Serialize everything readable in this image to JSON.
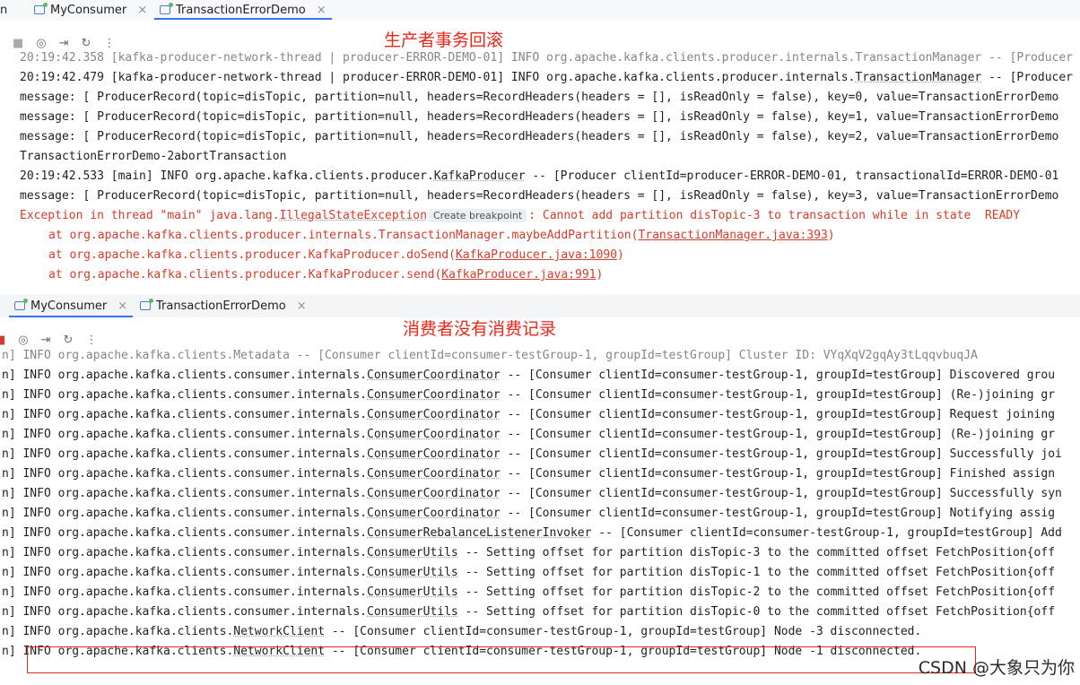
{
  "top_panel": {
    "tab_left_fragment": "n",
    "tabs": [
      {
        "label": "MyConsumer",
        "active": false
      },
      {
        "label": "TransactionErrorDemo",
        "active": true
      }
    ],
    "annotation": "生产者事务回滚",
    "create_breakpoint": "Create breakpoint",
    "lines": [
      {
        "kind": "partial",
        "text": "20:19:42.358 [kafka-producer-network-thread | producer-ERROR-DEMO-01] INFO org.apache.kafka.clients.producer.internals.TransactionManager -- [Producer"
      },
      {
        "kind": "log",
        "pre": "20:19:42.479 [kafka-producer-network-thread | producer-ERROR-DEMO-01] INFO org.apache.kafka.clients.producer.internals.",
        "cls": "TransactionManager",
        "post": " -- [Producer"
      },
      {
        "kind": "log",
        "pre": "message: [ ProducerRecord(topic=disTopic, partition=null, headers=RecordHeaders(headers = [], isReadOnly = false), key=0, value=TransactionErrorDemo"
      },
      {
        "kind": "log",
        "pre": "message: [ ProducerRecord(topic=disTopic, partition=null, headers=RecordHeaders(headers = [], isReadOnly = false), key=1, value=TransactionErrorDemo"
      },
      {
        "kind": "log",
        "pre": "message: [ ProducerRecord(topic=disTopic, partition=null, headers=RecordHeaders(headers = [], isReadOnly = false), key=2, value=TransactionErrorDemo"
      },
      {
        "kind": "log",
        "pre": "TransactionErrorDemo-2abortTransaction"
      },
      {
        "kind": "log",
        "pre": "20:19:42.533 [main] INFO org.apache.kafka.clients.producer.",
        "cls": "KafkaProducer",
        "post": " -- [Producer clientId=producer-ERROR-DEMO-01, transactionalId=ERROR-DEMO-01"
      },
      {
        "kind": "log",
        "pre": "message: [ ProducerRecord(topic=disTopic, partition=null, headers=RecordHeaders(headers = [], isReadOnly = false), key=3, value=TransactionErrorDemo"
      },
      {
        "kind": "err",
        "pre": "Exception in thread \"main\" java.lang.",
        "cls": "IllegalStateException",
        "post": ": Cannot add partition disTopic-3 to transaction while in state  READY"
      },
      {
        "kind": "trace",
        "pre": "at org.apache.kafka.clients.producer.internals.TransactionManager.maybeAddPartition(",
        "cls": "TransactionManager.java:393",
        "post": ")"
      },
      {
        "kind": "trace",
        "pre": "at org.apache.kafka.clients.producer.KafkaProducer.doSend(",
        "cls": "KafkaProducer.java:1090",
        "post": ")"
      },
      {
        "kind": "trace",
        "pre": "at org.apache.kafka.clients.producer.KafkaProducer.send(",
        "cls": "KafkaProducer.java:991",
        "post": ")"
      }
    ]
  },
  "bottom_panel": {
    "tabs": [
      {
        "label": "MyConsumer",
        "active": true
      },
      {
        "label": "TransactionErrorDemo",
        "active": false
      }
    ],
    "annotation": "消费者没有消费记录",
    "lines": [
      {
        "kind": "partial",
        "text": "n] INFO org.apache.kafka.clients.Metadata -- [Consumer clientId=consumer-testGroup-1, groupId=testGroup] Cluster ID: VYqXqV2gqAy3tLqqvbuqJA"
      },
      {
        "kind": "log",
        "pre": "n] INFO org.apache.kafka.clients.consumer.internals.",
        "cls": "ConsumerCoordinator",
        "post": " -- [Consumer clientId=consumer-testGroup-1, groupId=testGroup] Discovered grou"
      },
      {
        "kind": "log",
        "pre": "n] INFO org.apache.kafka.clients.consumer.internals.",
        "cls": "ConsumerCoordinator",
        "post": " -- [Consumer clientId=consumer-testGroup-1, groupId=testGroup] (Re-)joining gr"
      },
      {
        "kind": "log",
        "pre": "n] INFO org.apache.kafka.clients.consumer.internals.",
        "cls": "ConsumerCoordinator",
        "post": " -- [Consumer clientId=consumer-testGroup-1, groupId=testGroup] Request joining"
      },
      {
        "kind": "log",
        "pre": "n] INFO org.apache.kafka.clients.consumer.internals.",
        "cls": "ConsumerCoordinator",
        "post": " -- [Consumer clientId=consumer-testGroup-1, groupId=testGroup] (Re-)joining gr"
      },
      {
        "kind": "log",
        "pre": "n] INFO org.apache.kafka.clients.consumer.internals.",
        "cls": "ConsumerCoordinator",
        "post": " -- [Consumer clientId=consumer-testGroup-1, groupId=testGroup] Successfully joi"
      },
      {
        "kind": "log",
        "pre": "n] INFO org.apache.kafka.clients.consumer.internals.",
        "cls": "ConsumerCoordinator",
        "post": " -- [Consumer clientId=consumer-testGroup-1, groupId=testGroup] Finished assign"
      },
      {
        "kind": "log",
        "pre": "n] INFO org.apache.kafka.clients.consumer.internals.",
        "cls": "ConsumerCoordinator",
        "post": " -- [Consumer clientId=consumer-testGroup-1, groupId=testGroup] Successfully syn"
      },
      {
        "kind": "log",
        "pre": "n] INFO org.apache.kafka.clients.consumer.internals.",
        "cls": "ConsumerCoordinator",
        "post": " -- [Consumer clientId=consumer-testGroup-1, groupId=testGroup] Notifying assig"
      },
      {
        "kind": "log",
        "pre": "n] INFO org.apache.kafka.clients.consumer.internals.",
        "cls": "ConsumerRebalanceListenerInvoker",
        "post": " -- [Consumer clientId=consumer-testGroup-1, groupId=testGroup] Add"
      },
      {
        "kind": "log",
        "pre": "n] INFO org.apache.kafka.clients.consumer.internals.",
        "cls": "ConsumerUtils",
        "post": " -- Setting offset for partition disTopic-3 to the committed offset FetchPosition{off"
      },
      {
        "kind": "log",
        "pre": "n] INFO org.apache.kafka.clients.consumer.internals.",
        "cls": "ConsumerUtils",
        "post": " -- Setting offset for partition disTopic-1 to the committed offset FetchPosition{off"
      },
      {
        "kind": "log",
        "pre": "n] INFO org.apache.kafka.clients.consumer.internals.",
        "cls": "ConsumerUtils",
        "post": " -- Setting offset for partition disTopic-2 to the committed offset FetchPosition{off"
      },
      {
        "kind": "log",
        "pre": "n] INFO org.apache.kafka.clients.consumer.internals.",
        "cls": "ConsumerUtils",
        "post": " -- Setting offset for partition disTopic-0 to the committed offset FetchPosition{off"
      },
      {
        "kind": "log",
        "pre": "n] INFO org.apache.kafka.clients.",
        "cls": "NetworkClient",
        "post": " -- [Consumer clientId=consumer-testGroup-1, groupId=testGroup] Node -3 disconnected."
      },
      {
        "kind": "log",
        "pre": "n] INFO org.apache.kafka.clients.",
        "cls": "NetworkClient",
        "post": " -- [Consumer clientId=consumer-testGroup-1, groupId=testGroup] Node -1 disconnected."
      }
    ]
  },
  "watermark": "CSDN @大象只为你",
  "icons": {
    "stop": "■",
    "camera": "◎",
    "exit": "⇥",
    "restore": "↻",
    "more": "⋮",
    "close": "×"
  },
  "colors": {
    "error_text": "#d43c2c",
    "annotation": "#e8281c",
    "tab_accent": "#3574f0"
  }
}
